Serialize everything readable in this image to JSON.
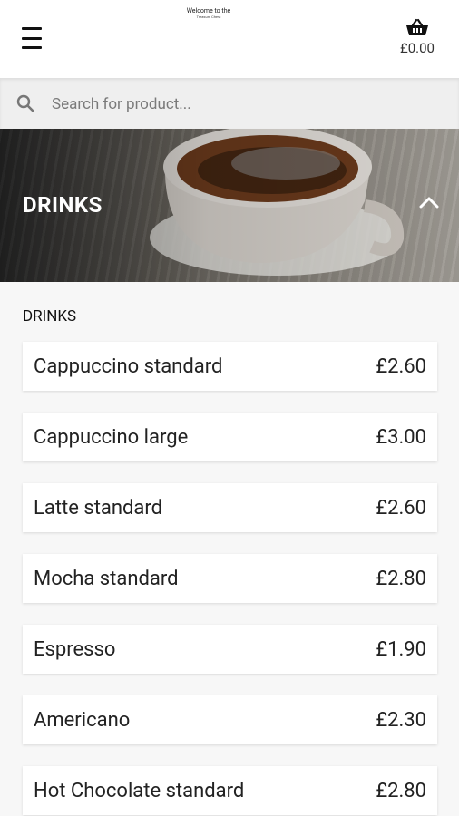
{
  "header": {
    "logo_line1": "Welcome to the",
    "logo_line2": "Treasure Chest",
    "basket_total": "£0.00"
  },
  "search": {
    "placeholder": "Search for product..."
  },
  "banner": {
    "title": "DRINKS"
  },
  "section": {
    "label": "DRINKS"
  },
  "products": [
    {
      "name": "Cappuccino standard",
      "price": "£2.60"
    },
    {
      "name": "Cappuccino large",
      "price": "£3.00"
    },
    {
      "name": "Latte standard",
      "price": "£2.60"
    },
    {
      "name": "Mocha standard",
      "price": "£2.80"
    },
    {
      "name": "Espresso",
      "price": "£1.90"
    },
    {
      "name": "Americano",
      "price": "£2.30"
    },
    {
      "name": "Hot Chocolate standard",
      "price": "£2.80"
    }
  ],
  "icons": {
    "menu": "menu-icon",
    "basket": "basket-icon",
    "search": "search-icon",
    "collapse": "chevron-up-icon"
  }
}
